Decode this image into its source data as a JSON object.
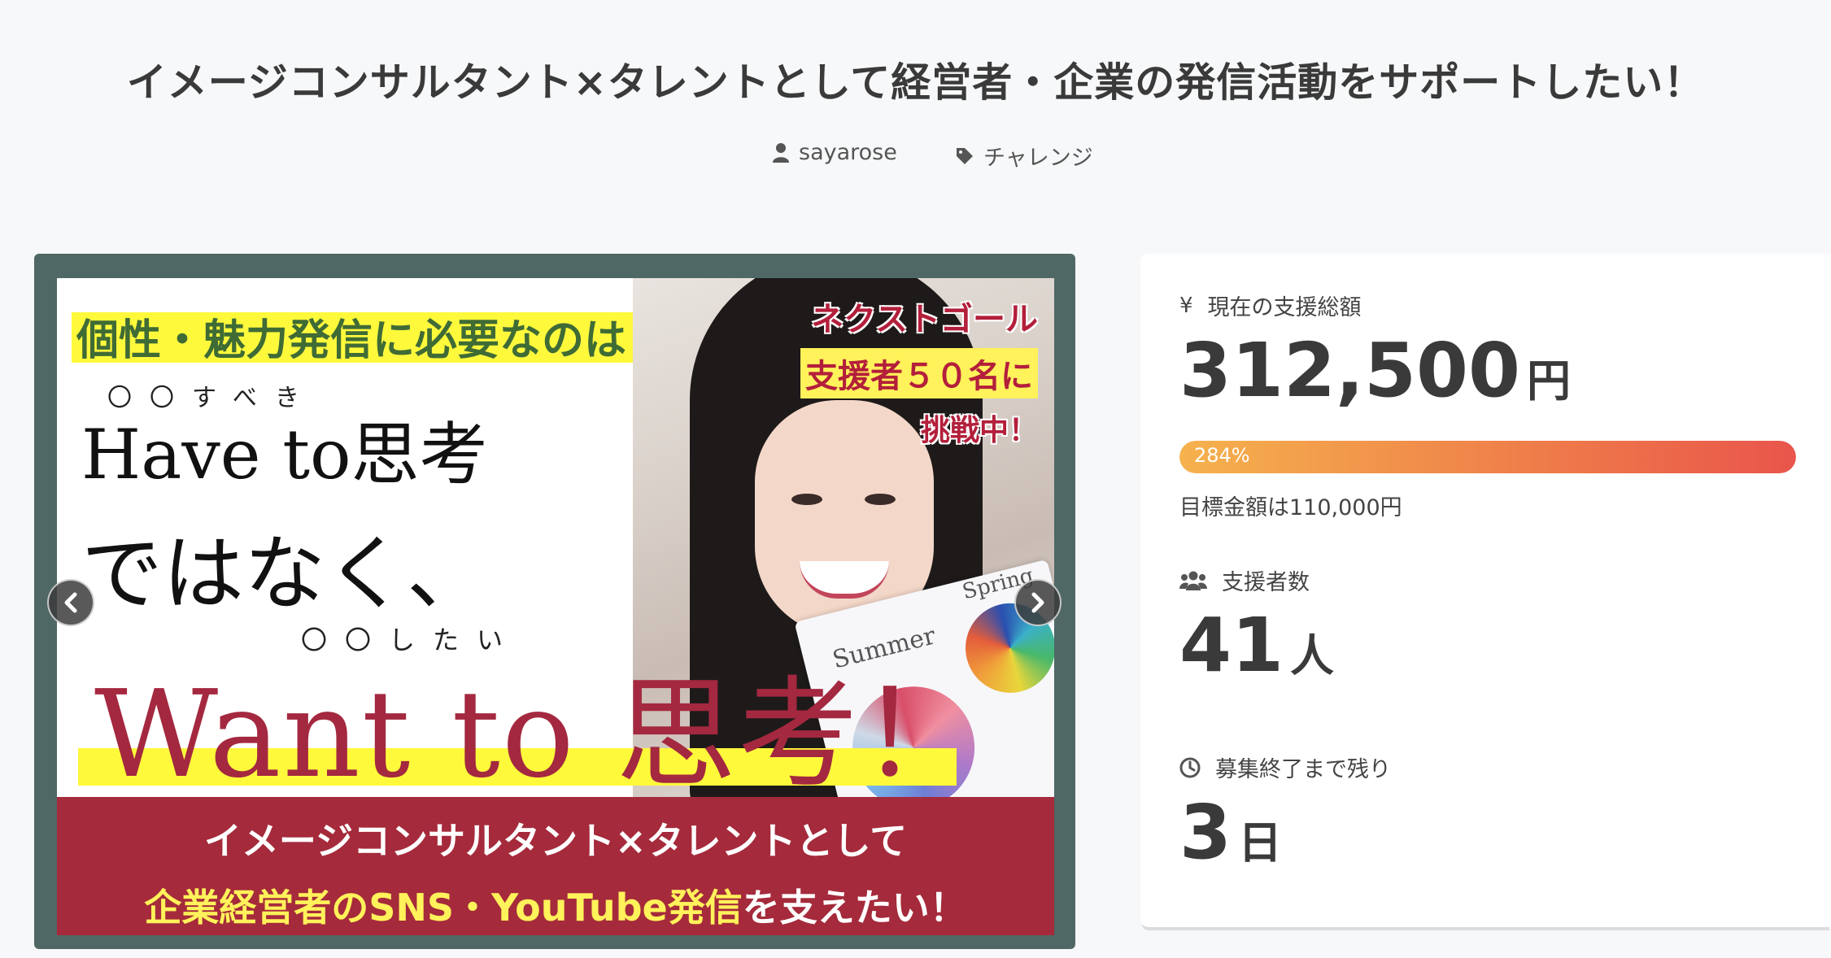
{
  "project": {
    "title": "イメージコンサルタント×タレントとして経営者・企業の発信活動をサポートしたい！",
    "author": "sayarose",
    "category": "チャレンジ"
  },
  "slide": {
    "headline": "個性・魅力発信に必要なのは",
    "ruby_have": "〇〇すべき",
    "have_to": "Have to思考",
    "dewanaku": "ではなく、",
    "ruby_want": "〇〇したい",
    "want_to": "Want to 思考！",
    "next_goal_line1": "ネクストゴール",
    "next_goal_line2": "支援者５０名に",
    "next_goal_line3": "挑戦中！",
    "card_label_summer": "Summer",
    "card_label_spring": "Spring",
    "band_line1": "イメージコンサルタント×タレントとして",
    "band_line2_highlight": "企業経営者のSNS・YouTube発信",
    "band_line2_rest": "を支えたい！"
  },
  "stats": {
    "yen_symbol": "¥",
    "total_label": "現在の支援総額",
    "total_value": "312,500",
    "total_unit": "円",
    "progress_percent": 284,
    "progress_label": "284%",
    "goal_text": "目標金額は110,000円",
    "backers_label": "支援者数",
    "backers_value": "41",
    "backers_unit": "人",
    "remaining_label": "募集終了まで残り",
    "remaining_value": "3",
    "remaining_unit": "日"
  },
  "icons": {
    "user": "user-icon",
    "tag": "tag-icon",
    "prev": "chevron-left-icon",
    "next": "chevron-right-icon",
    "backers": "users-icon",
    "clock": "clock-icon"
  },
  "colors": {
    "progress_start": "#f5b24d",
    "progress_end": "#e9554b",
    "slide_frame": "#4f6865",
    "band": "#a52a3b",
    "highlight": "#fff93c"
  }
}
